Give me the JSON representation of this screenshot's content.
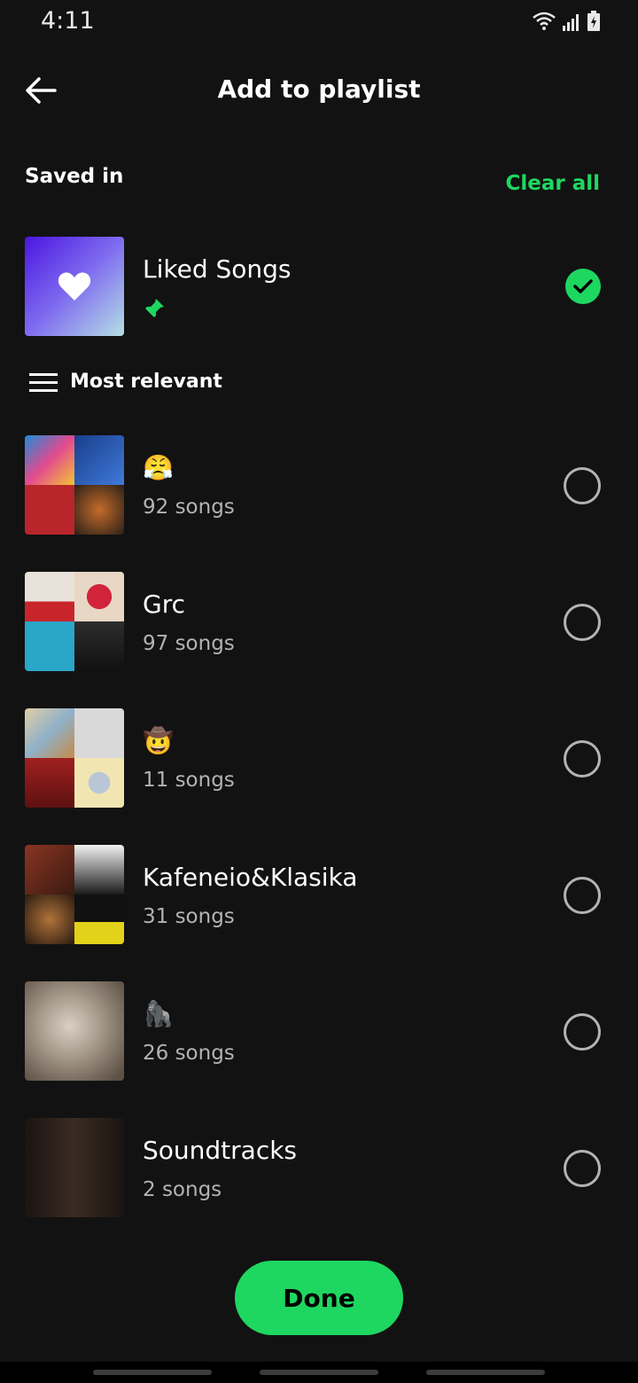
{
  "status_bar": {
    "time": "4:11"
  },
  "header": {
    "title": "Add to playlist"
  },
  "saved_in": {
    "label": "Saved in",
    "clear_all": "Clear all"
  },
  "liked": {
    "name": "Liked Songs"
  },
  "sort": {
    "label": "Most relevant"
  },
  "playlists": [
    {
      "name": "😤",
      "count": "92 songs",
      "colors": [
        "#3a6fd1",
        "#1e4fa8",
        "#b8262c",
        "#3b2a20"
      ]
    },
    {
      "name": "Grc",
      "count": "97 songs",
      "colors": [
        "#d8d0c6",
        "#e8d7c4",
        "#2aa6c9",
        "#2a2a2a"
      ]
    },
    {
      "name": "🤠",
      "count": "11 songs",
      "colors": [
        "#c9b28a",
        "#d4d4d4",
        "#8e1d1d",
        "#efe3b0"
      ]
    },
    {
      "name": "Kafeneio&Klasika",
      "count": "31 songs",
      "colors": [
        "#6a2a1e",
        "#e8e8e8",
        "#3a2418",
        "#e2d21a"
      ]
    },
    {
      "name": "🦍",
      "count": "26 songs",
      "colors": [
        "#8e8378",
        "#a0968c",
        "#7d6f62",
        "#5e5145"
      ]
    },
    {
      "name": "Soundtracks",
      "count": "2 songs",
      "colors": [
        "#2a211b",
        "#1b1613",
        "#3a2c22",
        "#1a1512"
      ]
    }
  ],
  "done_button": {
    "label": "Done"
  },
  "accent": "#1ed760"
}
